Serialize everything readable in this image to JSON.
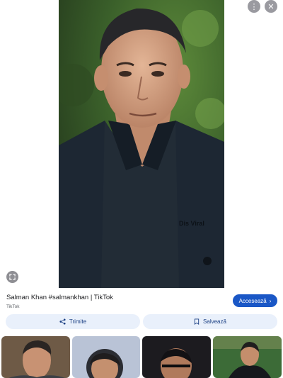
{
  "result": {
    "title": "Salman Khan #salmankhan | TikTok",
    "source": "TikTok",
    "watermark": "Dis Viral"
  },
  "actions": {
    "visit_label": "Accesează",
    "share_label": "Trimite",
    "save_label": "Salvează"
  },
  "thumbnails": [
    {
      "name": "related-image-1"
    },
    {
      "name": "related-image-2"
    },
    {
      "name": "related-image-3"
    },
    {
      "name": "related-image-4"
    }
  ],
  "colors": {
    "accent": "#1a57c6",
    "pill_bg": "#e9f0fb",
    "pill_text": "#1a3f83"
  }
}
